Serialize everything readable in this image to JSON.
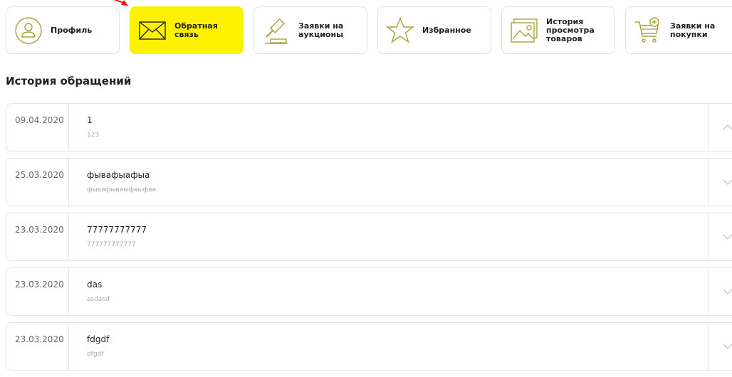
{
  "tabs": [
    {
      "label": "Профиль",
      "icon": "profile-icon",
      "active": false
    },
    {
      "label": "Обратная связь",
      "icon": "envelope-icon",
      "active": true
    },
    {
      "label": "Заявки на\nаукционы",
      "icon": "gavel-icon",
      "active": false
    },
    {
      "label": "Избранное",
      "icon": "star-icon",
      "active": false
    },
    {
      "label": "История\nпросмотра\nтоваров",
      "icon": "image-icon",
      "active": false
    },
    {
      "label": "Заявки на\nпокупки",
      "icon": "cart-plus-icon",
      "active": false
    }
  ],
  "section_title": "История обращений",
  "history": [
    {
      "date": "09.04.2020",
      "subject": "1",
      "message": "123",
      "expanded": true
    },
    {
      "date": "25.03.2020",
      "subject": "фывафыафыа",
      "message": "фывафываыфаыфва",
      "expanded": false
    },
    {
      "date": "23.03.2020",
      "subject": "77777777777",
      "message": "777777777777",
      "expanded": false
    },
    {
      "date": "23.03.2020",
      "subject": "das",
      "message": "asdasd",
      "expanded": false
    },
    {
      "date": "23.03.2020",
      "subject": "fdgdf",
      "message": "dfgdf",
      "expanded": false
    }
  ],
  "colors": {
    "accent": "#fff200",
    "icon_olive": "#a7a23a",
    "border": "#e3e3e3",
    "arrow": "#e01919"
  }
}
